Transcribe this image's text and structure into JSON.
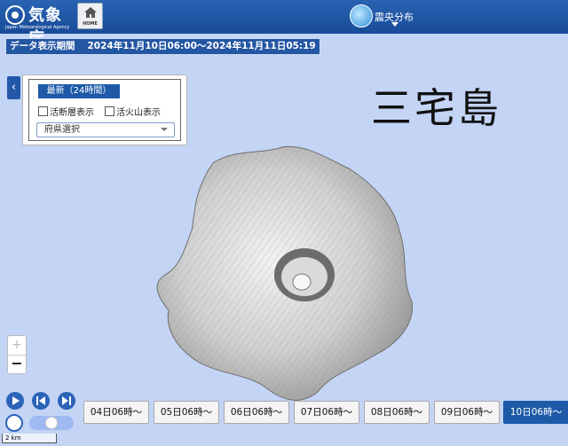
{
  "header": {
    "logo_jp": "気象庁",
    "logo_en": "Japan Meteorological Agency",
    "home_label": "HOME",
    "layer_label": "震央分布"
  },
  "period": {
    "label": "データ表示期間",
    "range": "2024年11月10日06:00～2024年11月11日05:19"
  },
  "panel": {
    "latest_button": "最新（24時間）",
    "fault_checkbox": "活断層表示",
    "volcano_checkbox": "活火山表示",
    "prefecture_select": "府県選択"
  },
  "map": {
    "place_name": "三宅島",
    "scale_label": "2 km"
  },
  "zoom": {
    "in": "+",
    "out": "−"
  },
  "timeline": {
    "days": [
      "04日06時～",
      "05日06時～",
      "06日06時～",
      "07日06時～",
      "08日06時～",
      "09日06時～",
      "10日06時～"
    ],
    "active_index": 6
  },
  "colors": {
    "header": "#1e55a4",
    "active": "#1e5aa8",
    "sea": "#c3d4f5"
  }
}
